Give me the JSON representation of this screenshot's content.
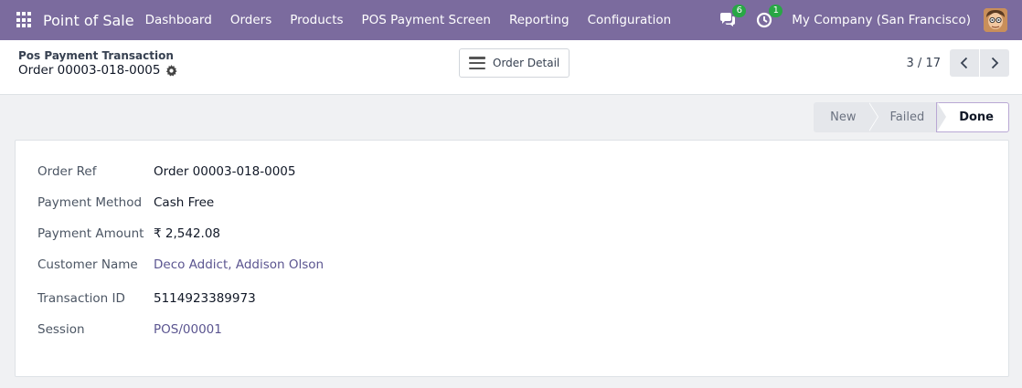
{
  "navbar": {
    "app_name": "Point of Sale",
    "menu": [
      "Dashboard",
      "Orders",
      "Products",
      "POS Payment Screen",
      "Reporting",
      "Configuration"
    ],
    "messages_count": "6",
    "activities_count": "1",
    "company": "My Company (San Francisco)"
  },
  "control_panel": {
    "breadcrumb_parent": "Pos Payment Transaction",
    "breadcrumb_current": "Order 00003-018-0005",
    "order_detail_label": "Order Detail",
    "pager": "3 / 17"
  },
  "statusbar": {
    "stages": [
      "New",
      "Failed",
      "Done"
    ],
    "active": "Done"
  },
  "form": {
    "fields": [
      {
        "label": "Order Ref",
        "value": "Order 00003-018-0005"
      },
      {
        "label": "Payment Method",
        "value": "Cash Free"
      },
      {
        "label": "Payment Amount",
        "value": "₹ 2,542.08"
      },
      {
        "label": "Customer Name",
        "value": "Deco Addict, Addison Olson"
      },
      {
        "label": "Transaction ID",
        "value": "5114923389973"
      },
      {
        "label": "Session",
        "value": "POS/00001"
      }
    ]
  },
  "colors": {
    "navbar": "#7b6b9e",
    "link": "#5b5590",
    "badge": "#28a745"
  }
}
